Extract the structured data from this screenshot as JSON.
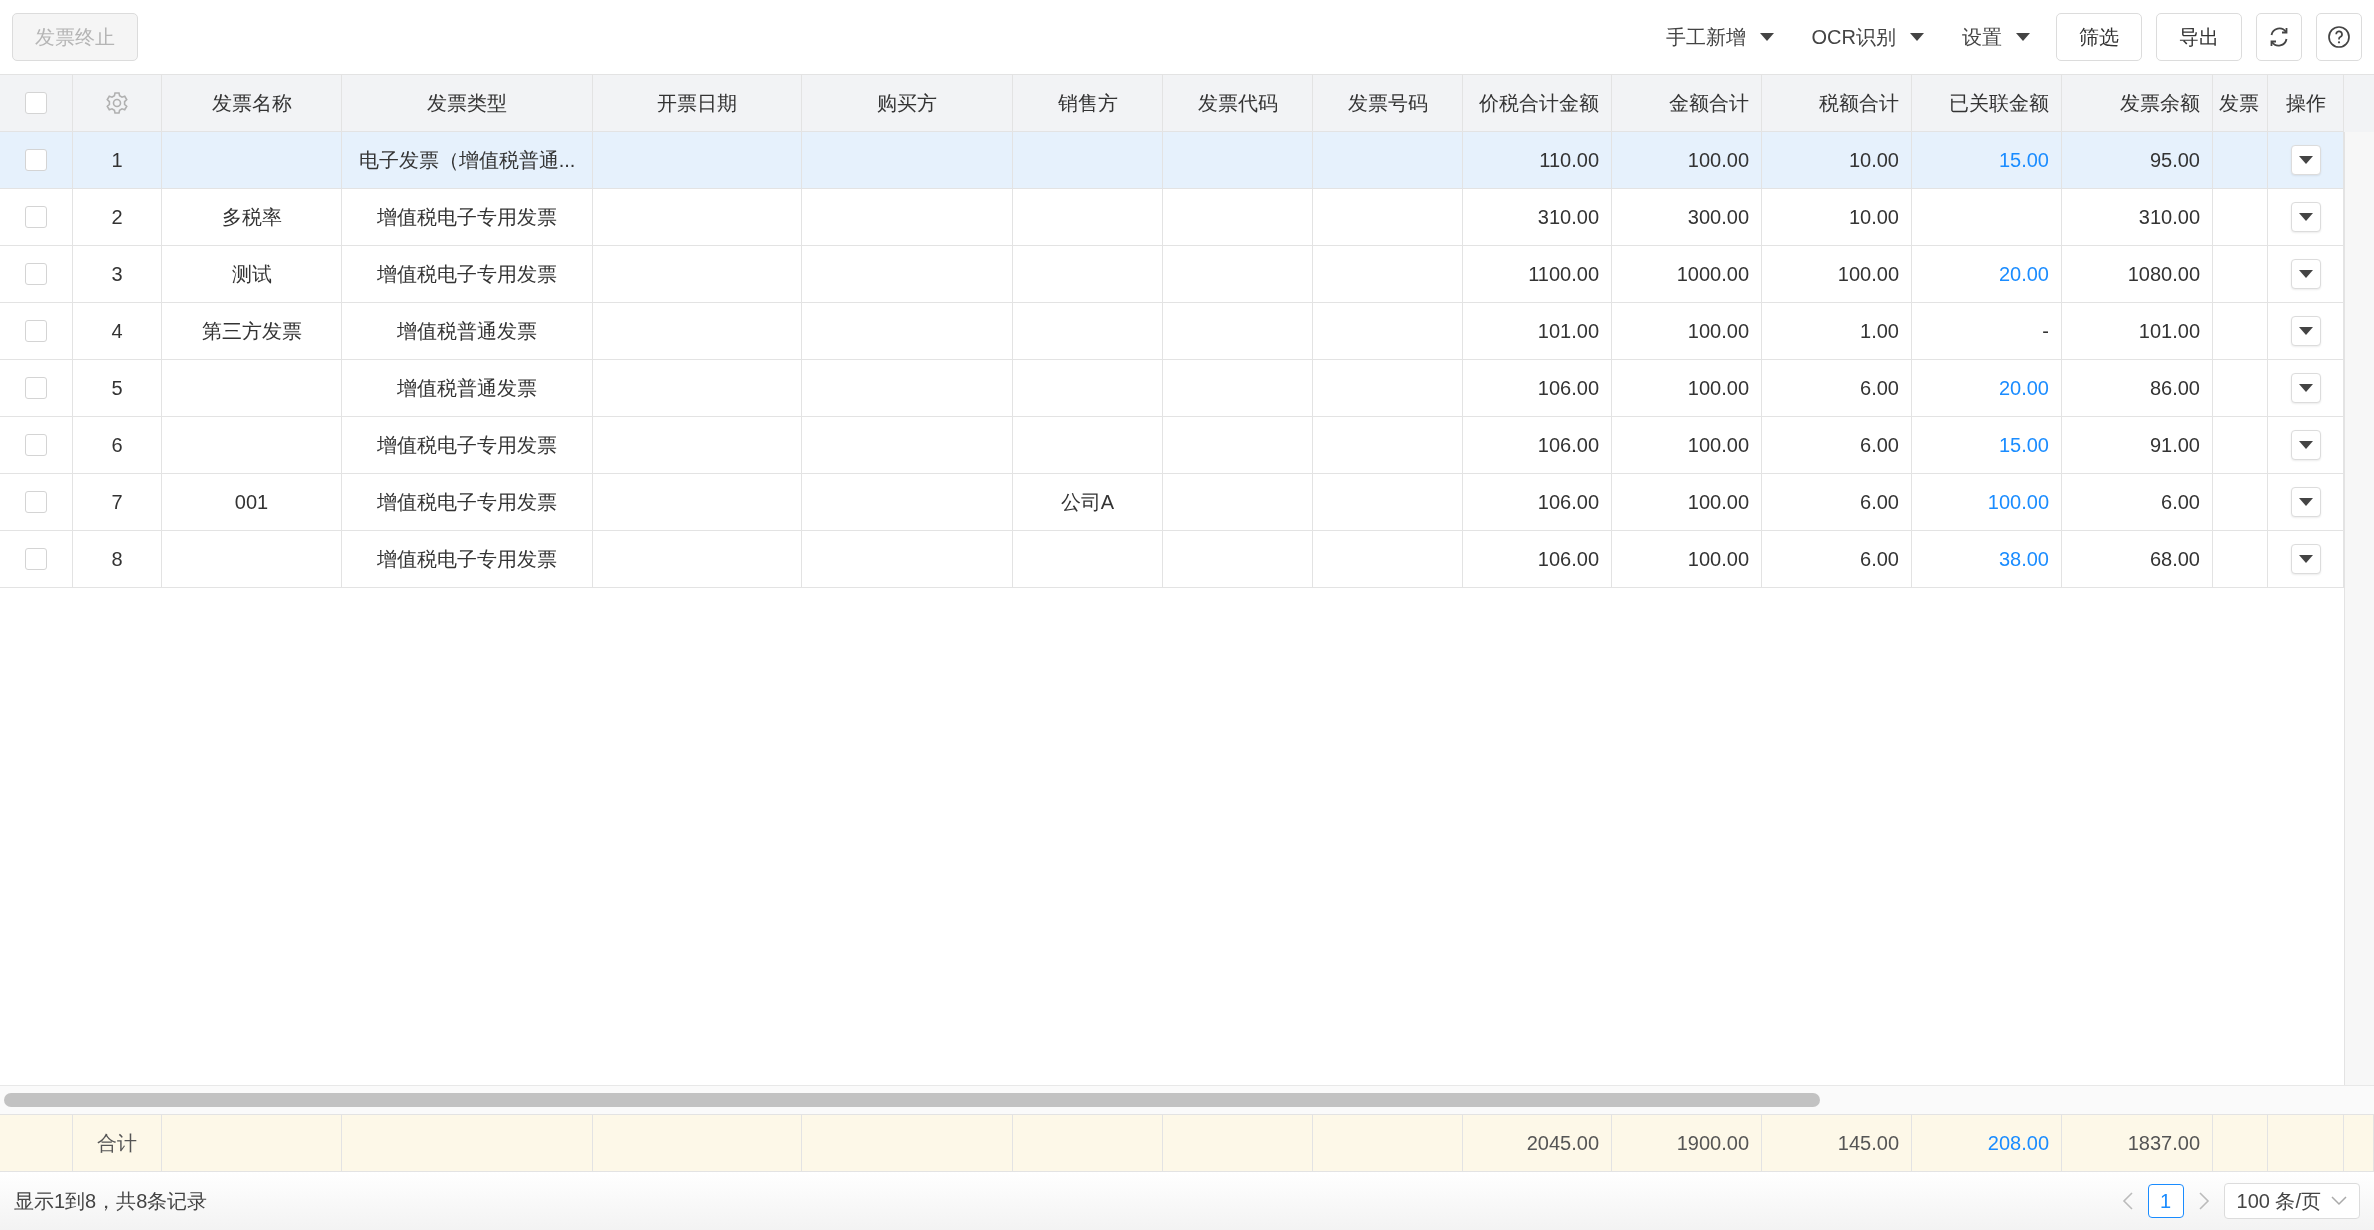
{
  "toolbar": {
    "terminate_button": {
      "label": "发票终止",
      "disabled": true
    },
    "menus": [
      {
        "label": "手工新增"
      },
      {
        "label": "OCR识别"
      },
      {
        "label": "设置"
      }
    ],
    "buttons": [
      {
        "label": "筛选"
      },
      {
        "label": "导出"
      }
    ]
  },
  "table": {
    "select_all_checked": false,
    "columns": [
      {
        "kind": "checkbox"
      },
      {
        "kind": "settings"
      },
      {
        "label": "发票名称",
        "kind": "text"
      },
      {
        "label": "发票类型",
        "kind": "text"
      },
      {
        "label": "开票日期",
        "kind": "text"
      },
      {
        "label": "购买方",
        "kind": "text"
      },
      {
        "label": "销售方",
        "kind": "text"
      },
      {
        "label": "发票代码",
        "kind": "text"
      },
      {
        "label": "发票号码",
        "kind": "text"
      },
      {
        "label": "价税合计金额",
        "kind": "number"
      },
      {
        "label": "金额合计",
        "kind": "number"
      },
      {
        "label": "税额合计",
        "kind": "number"
      },
      {
        "label": "已关联金额",
        "kind": "link"
      },
      {
        "label": "发票余额",
        "kind": "number"
      },
      {
        "label": "发票",
        "kind": "cut"
      },
      {
        "label": "操作",
        "kind": "action"
      }
    ],
    "rows": [
      {
        "no": "1",
        "selected": true,
        "checked": false,
        "type": "电子发票（增值税普通...",
        "total": "110.00",
        "amount": "100.00",
        "tax": "10.00",
        "linked": {
          "text": "15.00",
          "link": true
        },
        "balance": "95.00"
      },
      {
        "no": "2",
        "selected": false,
        "checked": false,
        "name": "多税率",
        "type": "增值税电子专用发票",
        "total": "310.00",
        "amount": "300.00",
        "tax": "10.00",
        "balance": "310.00"
      },
      {
        "no": "3",
        "selected": false,
        "checked": false,
        "name": "测试",
        "type": "增值税电子专用发票",
        "total": "1100.00",
        "amount": "1000.00",
        "tax": "100.00",
        "linked": {
          "text": "20.00",
          "link": true
        },
        "balance": "1080.00"
      },
      {
        "no": "4",
        "selected": false,
        "checked": false,
        "name": "第三方发票",
        "type": "增值税普通发票",
        "total": "101.00",
        "amount": "100.00",
        "tax": "1.00",
        "linked": {
          "text": "-",
          "link": false
        },
        "balance": "101.00"
      },
      {
        "no": "5",
        "selected": false,
        "checked": false,
        "type": "增值税普通发票",
        "total": "106.00",
        "amount": "100.00",
        "tax": "6.00",
        "linked": {
          "text": "20.00",
          "link": true
        },
        "balance": "86.00"
      },
      {
        "no": "6",
        "selected": false,
        "checked": false,
        "type": "增值税电子专用发票",
        "total": "106.00",
        "amount": "100.00",
        "tax": "6.00",
        "linked": {
          "text": "15.00",
          "link": true
        },
        "balance": "91.00"
      },
      {
        "no": "7",
        "selected": false,
        "checked": false,
        "name": "001",
        "type": "增值税电子专用发票",
        "seller": "公司A",
        "total": "106.00",
        "amount": "100.00",
        "tax": "6.00",
        "linked": {
          "text": "100.00",
          "link": true
        },
        "balance": "6.00"
      },
      {
        "no": "8",
        "selected": false,
        "checked": false,
        "type": "增值税电子专用发票",
        "total": "106.00",
        "amount": "100.00",
        "tax": "6.00",
        "linked": {
          "text": "38.00",
          "link": true
        },
        "balance": "68.00"
      }
    ],
    "totals": {
      "label": "合计",
      "total": "2045.00",
      "amount": "1900.00",
      "tax": "145.00",
      "linked": {
        "text": "208.00",
        "link": true
      },
      "balance": "1837.00"
    }
  },
  "pagination": {
    "summary": "显示1到8，共8条记录",
    "pages": [
      {
        "label": "1",
        "selected": true
      }
    ],
    "page_size": "100 条/页"
  }
}
